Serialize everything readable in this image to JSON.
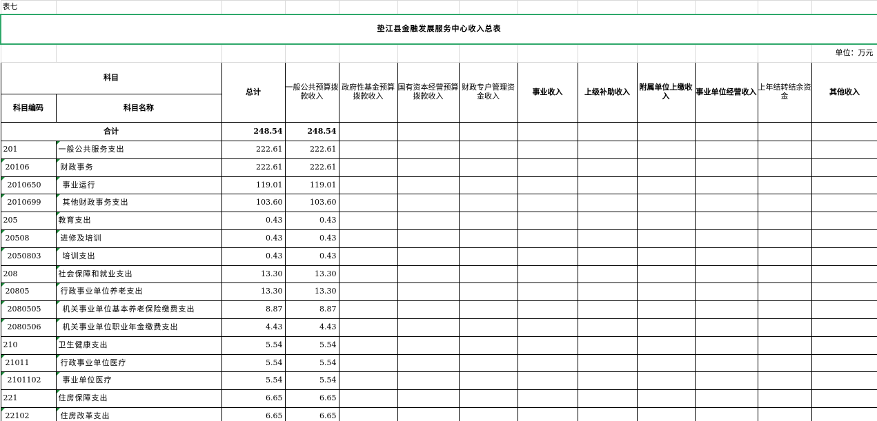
{
  "sheet_tag": "表七",
  "title": "垫江县金融发展服务中心收入总表",
  "unit": "单位：万元",
  "header": {
    "subject": "科目",
    "code": "科目编码",
    "name": "科目名称",
    "columns": [
      "总计",
      "一般公共预算拨款收入",
      "政府性基金预算拨款收入",
      "国有资本经营预算拨款收入",
      "财政专户管理资金收入",
      "事业收入",
      "上级补助收入",
      "附属单位上缴收入",
      "事业单位经营收入",
      "上年结转结余资金",
      "其他收入"
    ]
  },
  "total_row": {
    "label": "合计",
    "total": "248.54",
    "general": "248.54"
  },
  "rows": [
    {
      "code": "201",
      "name": "一般公共服务支出",
      "total": "222.61",
      "general": "222.61"
    },
    {
      "code": "20106",
      "name": "财政事务",
      "total": "222.61",
      "general": "222.61"
    },
    {
      "code": "2010650",
      "name": "事业运行",
      "total": "119.01",
      "general": "119.01"
    },
    {
      "code": "2010699",
      "name": "其他财政事务支出",
      "total": "103.60",
      "general": "103.60"
    },
    {
      "code": "205",
      "name": "教育支出",
      "total": "0.43",
      "general": "0.43"
    },
    {
      "code": "20508",
      "name": "进修及培训",
      "total": "0.43",
      "general": "0.43"
    },
    {
      "code": "2050803",
      "name": "培训支出",
      "total": "0.43",
      "general": "0.43"
    },
    {
      "code": "208",
      "name": "社会保障和就业支出",
      "total": "13.30",
      "general": "13.30"
    },
    {
      "code": "20805",
      "name": "行政事业单位养老支出",
      "total": "13.30",
      "general": "13.30"
    },
    {
      "code": "2080505",
      "name": "机关事业单位基本养老保险缴费支出",
      "total": "8.87",
      "general": "8.87"
    },
    {
      "code": "2080506",
      "name": "机关事业单位职业年金缴费支出",
      "total": "4.43",
      "general": "4.43"
    },
    {
      "code": "210",
      "name": "卫生健康支出",
      "total": "5.54",
      "general": "5.54"
    },
    {
      "code": "21011",
      "name": "行政事业单位医疗",
      "total": "5.54",
      "general": "5.54"
    },
    {
      "code": "2101102",
      "name": "事业单位医疗",
      "total": "5.54",
      "general": "5.54"
    },
    {
      "code": "221",
      "name": "住房保障支出",
      "total": "6.65",
      "general": "6.65"
    },
    {
      "code": "22102",
      "name": "住房改革支出",
      "total": "6.65",
      "general": "6.65"
    }
  ]
}
